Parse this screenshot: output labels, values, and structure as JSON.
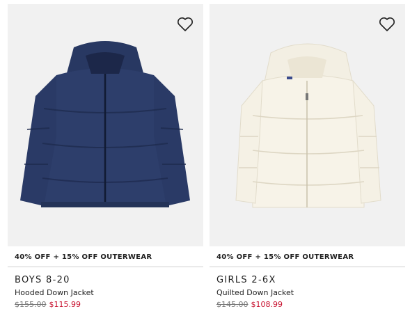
{
  "products": [
    {
      "promo": "40% OFF + 15% OFF OUTERWEAR",
      "category": "BOYS 8-20",
      "name": "Hooded Down Jacket",
      "original_price": "$155.00",
      "sale_price": "$115.99",
      "jacket_color": "#2d3e6b"
    },
    {
      "promo": "40% OFF + 15% OFF OUTERWEAR",
      "category": "GIRLS 2-6X",
      "name": "Quilted Down Jacket",
      "original_price": "$145.00",
      "sale_price": "$108.99",
      "jacket_color": "#f7f3e8"
    }
  ],
  "colors": {
    "sale": "#c8102e",
    "image_bg": "#f1f1f1"
  }
}
